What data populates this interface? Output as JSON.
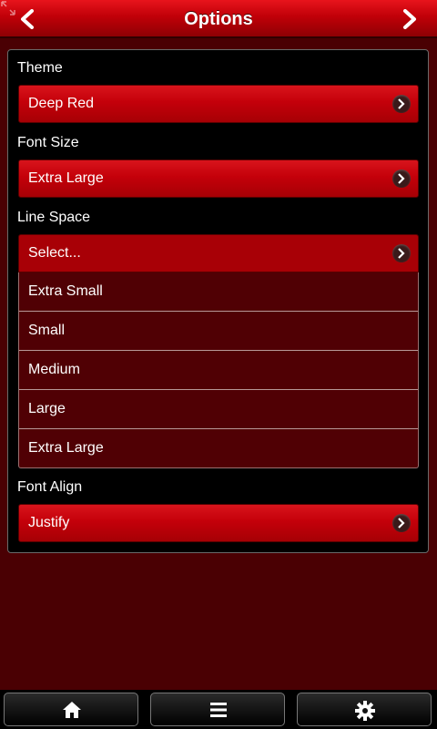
{
  "header": {
    "title": "Options"
  },
  "sections": [
    {
      "label": "Theme",
      "value": "Deep Red"
    },
    {
      "label": "Font Size",
      "value": "Extra Large"
    },
    {
      "label": "Line Space",
      "value": "Select...",
      "options": [
        "Extra Small",
        "Small",
        "Medium",
        "Large",
        "Extra Large"
      ]
    },
    {
      "label": "Font Align",
      "value": "Justify"
    }
  ],
  "tabbar": {
    "icons": [
      "home-icon",
      "menu-icon",
      "gear-icon"
    ]
  },
  "colors": {
    "accent": "#c4000a",
    "background": "#4a0003",
    "panel": "#000000"
  }
}
